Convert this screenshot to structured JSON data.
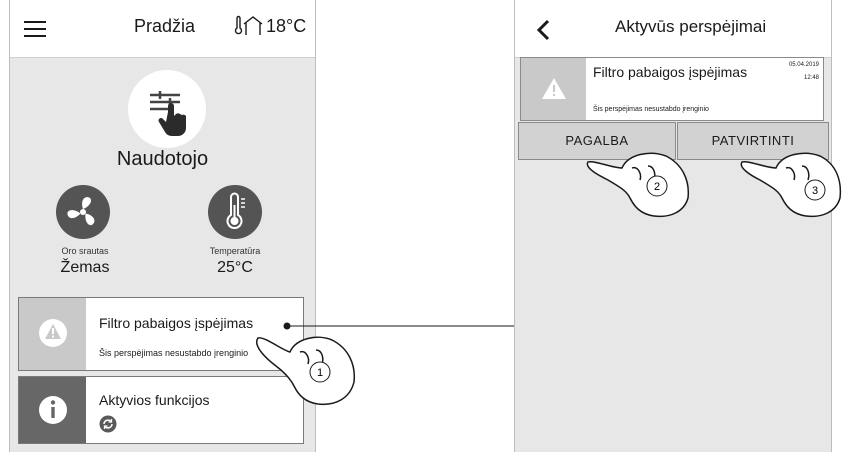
{
  "left_screen": {
    "title": "Pradžia",
    "temperature": "18°C",
    "mode": "Naudotojo",
    "airflow": {
      "caption": "Oro srautas",
      "value": "Žemas"
    },
    "temp_setpoint": {
      "caption": "Temperatūra",
      "value": "25°C"
    },
    "warning_card": {
      "title": "Filtro pabaigos įspėjimas",
      "subtitle": "Šis perspėjimas nesustabdo įrenginio"
    },
    "active_card": {
      "title": "Aktyvios funkcijos"
    }
  },
  "right_screen": {
    "title": "Aktyvūs perspėjimai",
    "alert": {
      "title": "Filtro pabaigos įspėjimas",
      "date": "05.04.2019",
      "time": "12:48",
      "subtitle": "Šis perspėjimas nesustabdo įrenginio"
    },
    "help_label": "PAGALBA",
    "confirm_label": "PATVIRTINTI"
  },
  "callouts": [
    "1",
    "2",
    "3"
  ],
  "colors": {
    "screen_bg": "#e7e7e7",
    "dark_icon": "#545454",
    "button_bg": "#d2d2d2"
  }
}
